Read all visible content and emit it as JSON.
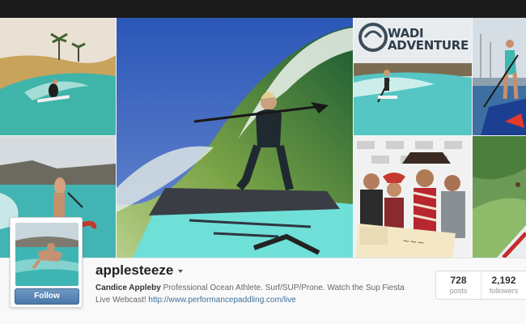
{
  "header": {
    "background": "#1a1a1a"
  },
  "photos": [
    {
      "id": "t1",
      "subject": "surfer on wave in desert wave pool with palm trees"
    },
    {
      "id": "t2",
      "subject": "woman paddleboarding on turquoise water"
    },
    {
      "id": "t3",
      "subject": "woman surfing a wave on a stand-up paddleboard"
    },
    {
      "id": "t4",
      "subject": "paddleboarder at wave park",
      "sign_text": "WADI ADVENTURE"
    },
    {
      "id": "t5",
      "subject": "group of men holding an oversized cheque"
    },
    {
      "id": "t6",
      "subject": "woman standing on paddleboard with paddle"
    },
    {
      "id": "t7",
      "subject": "paddleboarder on green water"
    }
  ],
  "profile": {
    "username": "applesteeze",
    "full_name": "Candice Appleby",
    "bio": " Professional Ocean Athlete. Surf/SUP/Prone. Watch the Sup Fiesta Live Webcast! ",
    "website": "http://www.performancepaddling.com/live",
    "follow_label": "Follow"
  },
  "stats": {
    "posts_count": "728",
    "posts_label": "posts",
    "followers_count": "2,192",
    "followers_label": "followers"
  },
  "colors": {
    "link": "#3f729b",
    "follow_button": "#4a77a8"
  }
}
